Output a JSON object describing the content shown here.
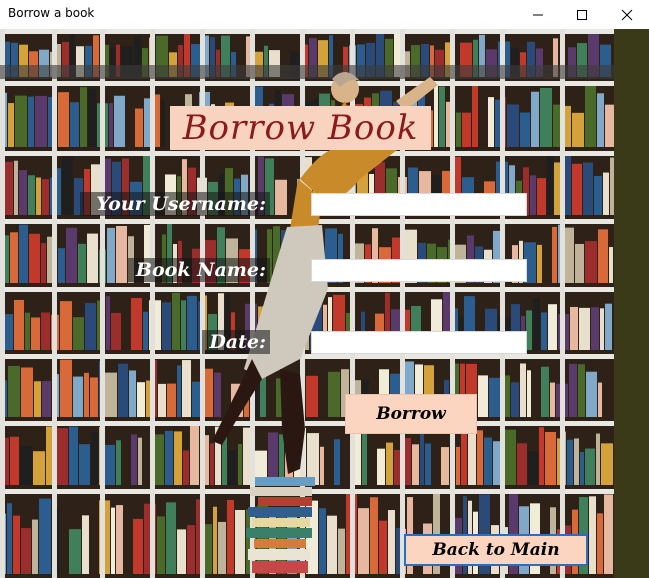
{
  "window": {
    "title": "Borrow a book",
    "controls": {
      "minimize_icon": "minimize-icon",
      "maximize_icon": "maximize-icon",
      "close_icon": "close-icon"
    }
  },
  "form": {
    "heading": "Borrow Book",
    "username_label": "Your Username:",
    "username_value": "",
    "bookname_label": "Book Name:",
    "bookname_value": "",
    "date_label": "Date:",
    "date_value": "",
    "borrow_button": "Borrow",
    "back_button": "Back to Main"
  },
  "colors": {
    "heading_bg": "#f8d4c0",
    "heading_text": "#8b1a1a",
    "button_bg": "#fbd5bf",
    "back_button_border": "#2a6fbf",
    "label_bg": "rgba(20,20,20,0.55)"
  },
  "background": "bookshelf-photo"
}
